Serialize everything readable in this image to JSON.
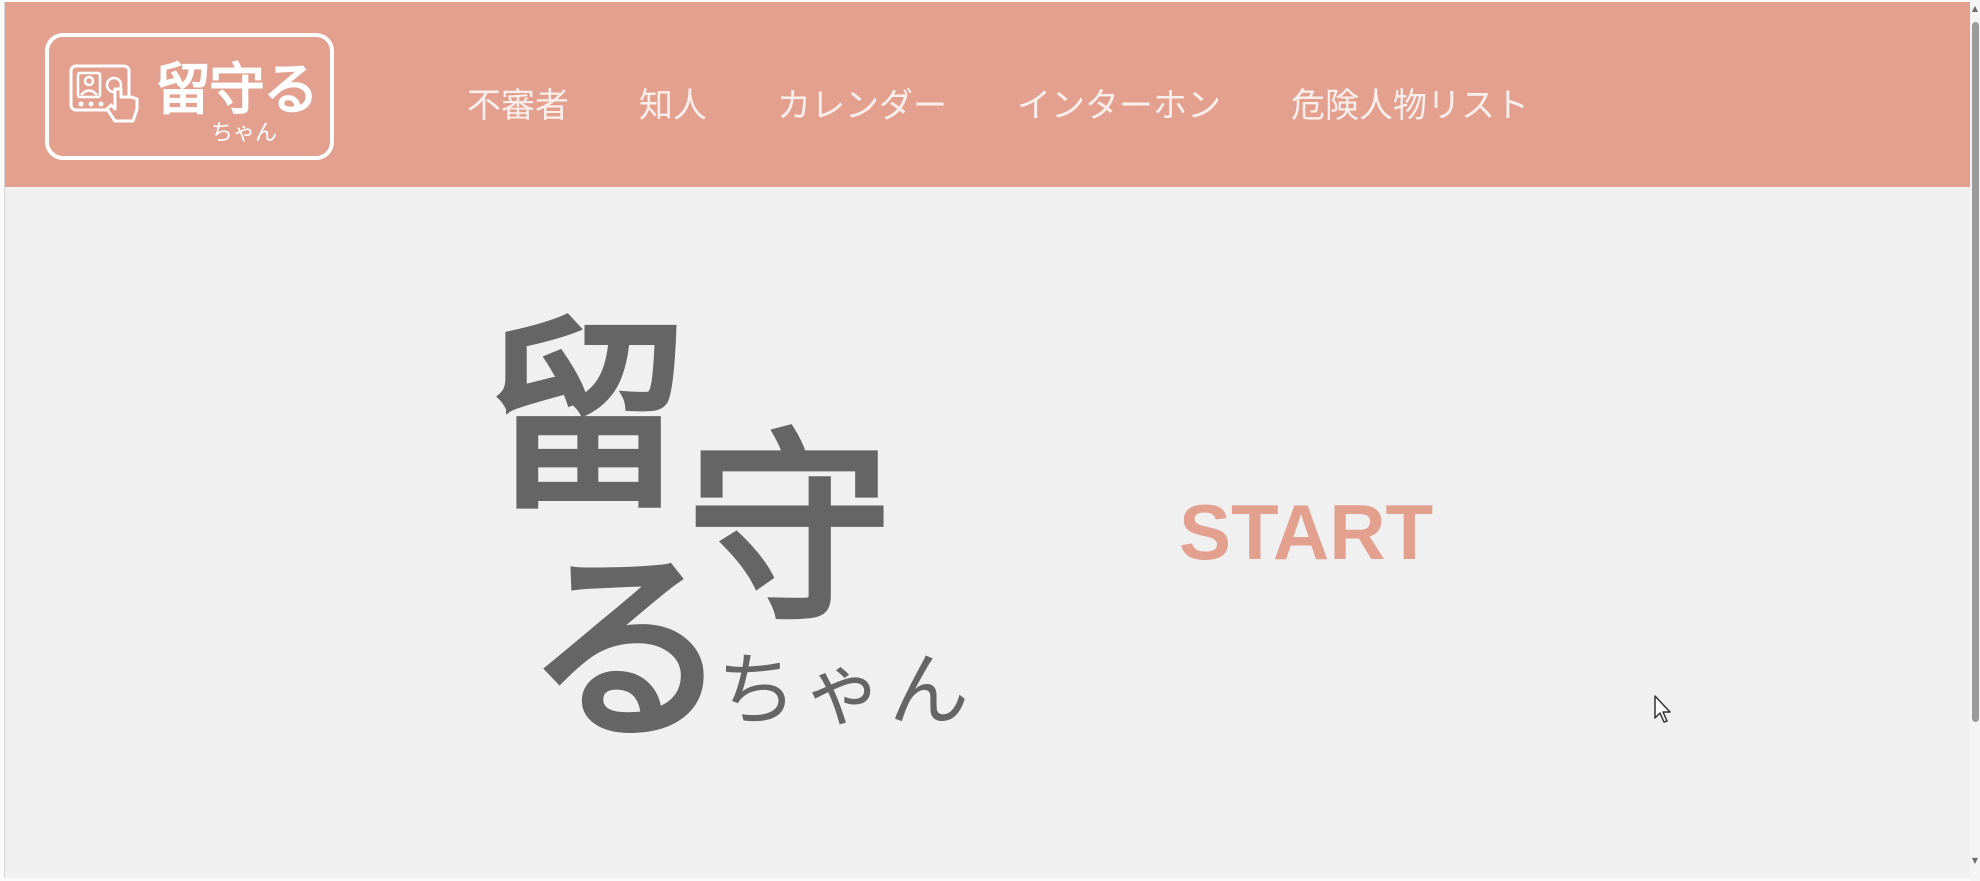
{
  "header": {
    "logo": {
      "title": "留守る",
      "subtitle": "ちゃん",
      "icon": "intercom-touch-icon"
    },
    "nav": [
      {
        "label": "不審者"
      },
      {
        "label": "知人"
      },
      {
        "label": "カレンダー"
      },
      {
        "label": "インターホン"
      },
      {
        "label": "危険人物リスト"
      }
    ],
    "background_color": "#e4a08f"
  },
  "hero": {
    "title_chars": [
      "留",
      "守",
      "る"
    ],
    "subtitle": "ちゃん",
    "start_label": "START",
    "title_color": "#656565",
    "accent_color": "#e4a08f"
  },
  "cursor": {
    "icon": "mouse-pointer-icon"
  }
}
